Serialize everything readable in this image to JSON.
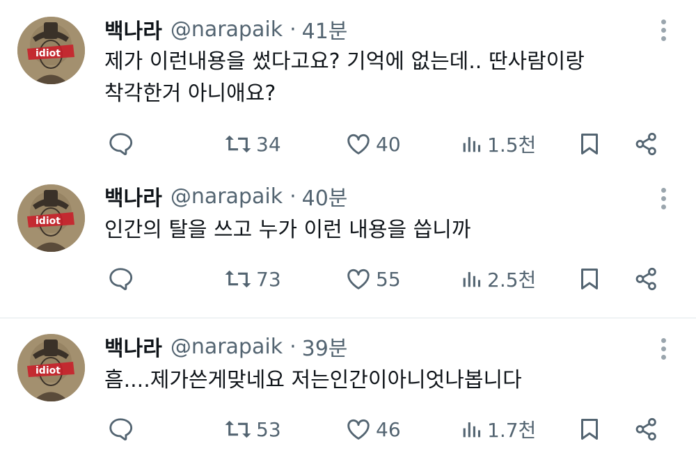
{
  "tweets": [
    {
      "name": "백나라",
      "handle": "@narapaik",
      "time": "41분",
      "avatar_text": "idiot",
      "lines": [
        "제가 이런내용을 썼다고요? 기억에 없는데.. 딴사람이랑",
        "착각한거 아니애요?"
      ],
      "retweets": "34",
      "likes": "40",
      "views": "1.5천"
    },
    {
      "name": "백나라",
      "handle": "@narapaik",
      "time": "40분",
      "avatar_text": "idiot",
      "lines": [
        "인간의 탈을 쓰고 누가 이런 내용을 씁니까"
      ],
      "retweets": "73",
      "likes": "55",
      "views": "2.5천"
    },
    {
      "name": "백나라",
      "handle": "@narapaik",
      "time": "39분",
      "avatar_text": "idiot",
      "lines": [
        "흠....제가쓴게맞네요 저는인간이아니엇나봅니다"
      ],
      "retweets": "53",
      "likes": "46",
      "views": "1.7천"
    }
  ],
  "separator": "·",
  "icons": [
    "reply-icon",
    "retweet-icon",
    "like-icon",
    "views-icon",
    "bookmark-icon",
    "share-icon",
    "more-icon"
  ],
  "colors": {
    "text": "#0f1419",
    "secondary": "#536471",
    "divider": "#eff3f4",
    "avatar_label": "#c8202a"
  }
}
